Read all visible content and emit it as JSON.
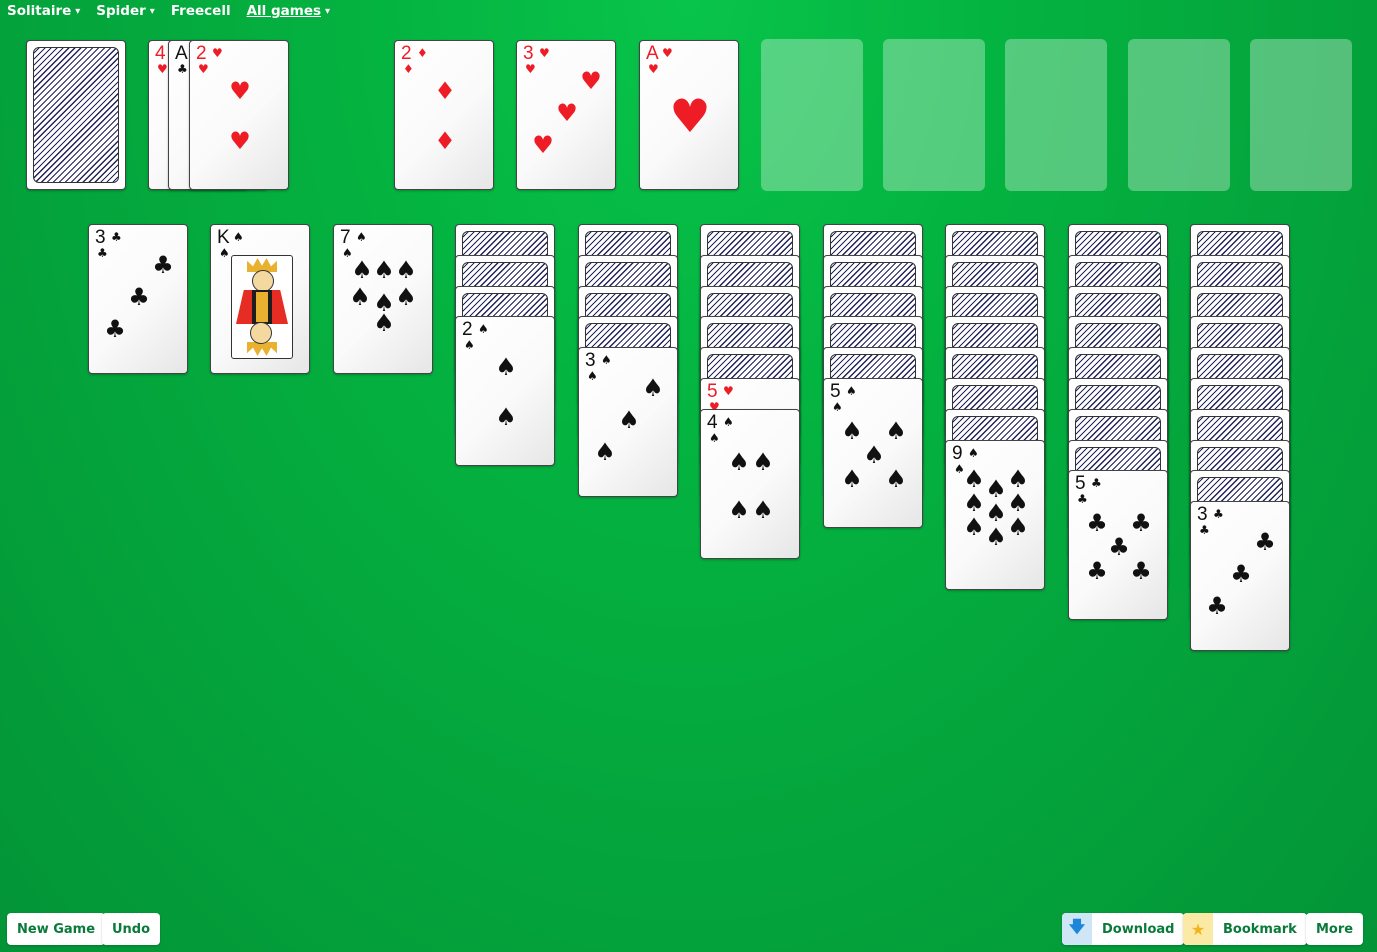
{
  "nav": {
    "items": [
      {
        "label": "Solitaire",
        "caret": "▾"
      },
      {
        "label": "Spider",
        "caret": "▾"
      },
      {
        "label": "Freecell",
        "caret": ""
      },
      {
        "label": "All games",
        "caret": "▾"
      }
    ]
  },
  "stock": {
    "state": "face-down"
  },
  "waste": [
    {
      "rank": "4",
      "suit": "♥",
      "color": "red"
    },
    {
      "rank": "A",
      "suit": "♣",
      "color": "black"
    },
    {
      "rank": "2",
      "suit": "♥",
      "color": "red"
    }
  ],
  "foundations": [
    {
      "rank": "2",
      "suit": "♦",
      "color": "red"
    },
    {
      "rank": "3",
      "suit": "♥",
      "color": "red"
    },
    {
      "rank": "A",
      "suit": "♥",
      "color": "red"
    }
  ],
  "empty_foundation_slots": 5,
  "tableau": [
    {
      "hidden": 0,
      "face_up": [
        {
          "rank": "3",
          "suit": "♣",
          "color": "black"
        }
      ]
    },
    {
      "hidden": 0,
      "face_up": [
        {
          "rank": "K",
          "suit": "♠",
          "color": "black"
        }
      ]
    },
    {
      "hidden": 0,
      "face_up": [
        {
          "rank": "7",
          "suit": "♠",
          "color": "black"
        }
      ]
    },
    {
      "hidden": 3,
      "face_up": [
        {
          "rank": "2",
          "suit": "♠",
          "color": "black"
        }
      ]
    },
    {
      "hidden": 4,
      "face_up": [
        {
          "rank": "3",
          "suit": "♠",
          "color": "black"
        }
      ]
    },
    {
      "hidden": 5,
      "face_up": [
        {
          "rank": "5",
          "suit": "♥",
          "color": "red"
        },
        {
          "rank": "4",
          "suit": "♠",
          "color": "black"
        }
      ]
    },
    {
      "hidden": 5,
      "face_up": [
        {
          "rank": "5",
          "suit": "♠",
          "color": "black"
        }
      ]
    },
    {
      "hidden": 7,
      "face_up": [
        {
          "rank": "9",
          "suit": "♠",
          "color": "black"
        }
      ]
    },
    {
      "hidden": 8,
      "face_up": [
        {
          "rank": "5",
          "suit": "♣",
          "color": "black"
        }
      ]
    },
    {
      "hidden": 9,
      "face_up": [
        {
          "rank": "3",
          "suit": "♣",
          "color": "black"
        }
      ]
    }
  ],
  "buttons": {
    "new_game": "New Game",
    "undo": "Undo",
    "download": "Download",
    "bookmark": "Bookmark",
    "more": "More"
  },
  "icons": {
    "download": "download-arrow-icon",
    "bookmark": "star-icon"
  },
  "colors": {
    "felt": "#04b240",
    "button_text": "#0a7a3a",
    "red_suit": "#ee1c25",
    "download_bg": "#cfe6f7",
    "bookmark_bg": "#fbe9a6"
  }
}
